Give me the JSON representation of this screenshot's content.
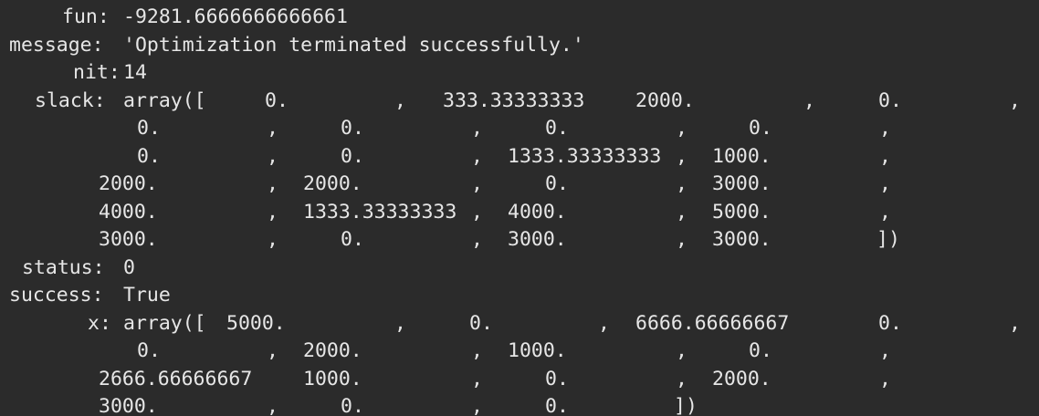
{
  "fun": {
    "key": "fun:",
    "value": "-9281.6666666666661"
  },
  "message": {
    "key": "message:",
    "value": "'Optimization terminated successfully.'"
  },
  "nit": {
    "key": "nit:",
    "value": "14"
  },
  "slack": {
    "key": "slack:",
    "open": "array([",
    "close": "])",
    "values": [
      [
        "0.",
        "333.33333333",
        "2000.",
        "0."
      ],
      [
        "0.",
        "0.",
        "0.",
        "0."
      ],
      [
        "0.",
        "0.",
        "1333.33333333",
        "1000."
      ],
      [
        "2000.",
        "2000.",
        "0.",
        "3000."
      ],
      [
        "4000.",
        "1333.33333333",
        "4000.",
        "5000."
      ],
      [
        "3000.",
        "0.",
        "3000.",
        "3000."
      ]
    ]
  },
  "status": {
    "key": "status:",
    "value": "0"
  },
  "success": {
    "key": "success:",
    "value": "True"
  },
  "x": {
    "key": "x:",
    "open": "array([",
    "close": "])",
    "values": [
      [
        "5000.",
        "0.",
        "6666.66666667",
        "0."
      ],
      [
        "0.",
        "2000.",
        "1000.",
        "0."
      ],
      [
        "2666.66666667",
        "1000.",
        "0.",
        "2000."
      ],
      [
        "3000.",
        "0.",
        "0."
      ]
    ]
  },
  "separator": ","
}
